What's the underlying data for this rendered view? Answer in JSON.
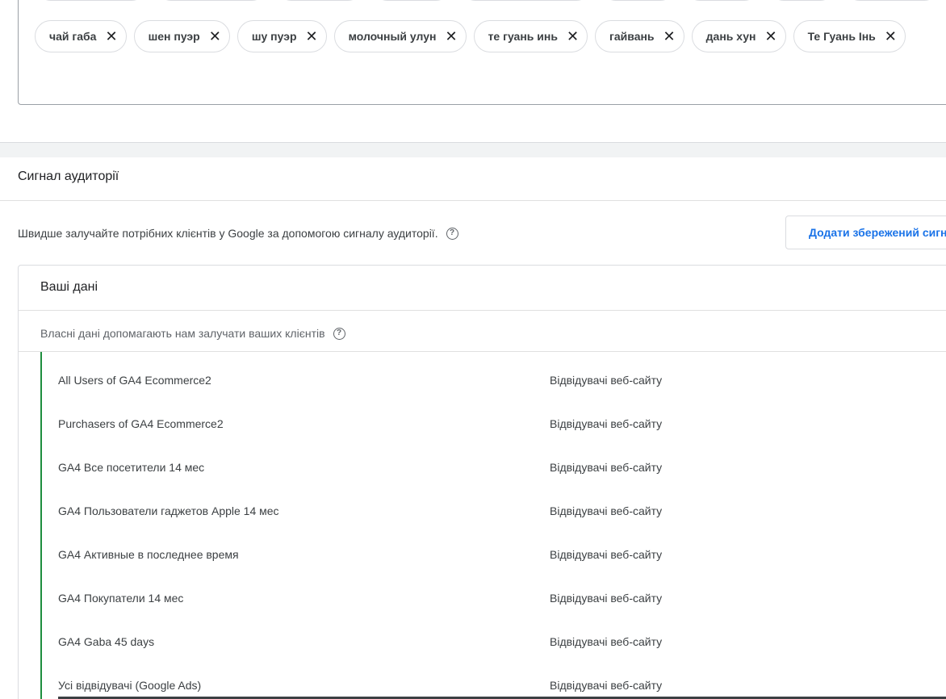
{
  "keywords": {
    "chips": [
      {
        "label": "чай габа"
      },
      {
        "label": "шен пуэр"
      },
      {
        "label": "шу пуэр"
      },
      {
        "label": "молочный улун"
      },
      {
        "label": "те гуань инь"
      },
      {
        "label": "гайвань"
      },
      {
        "label": "дань хун"
      },
      {
        "label": "Те Гуань Інь"
      }
    ],
    "remove_glyph": "✕"
  },
  "audience_signal": {
    "title": "Сигнал аудиторії",
    "description": "Швидше залучайте потрібних клієнтів у Google за допомогою сигналу аудиторії.",
    "add_saved_button": "Додати збережений сигнал",
    "help_icon": "help-circle-icon"
  },
  "your_data": {
    "title": "Ваші дані",
    "subtitle": "Власні дані допомагають нам залучати ваших клієнтів",
    "help_icon": "help-circle-icon",
    "accent_color": "#1e8e3e",
    "audiences": [
      {
        "name": "All Users of GA4 Ecommerce2",
        "type": "Відвідувачі веб-сайту"
      },
      {
        "name": "Purchasers of GA4 Ecommerce2",
        "type": "Відвідувачі веб-сайту"
      },
      {
        "name": "GA4 Все посетители 14 мес",
        "type": "Відвідувачі веб-сайту"
      },
      {
        "name": "GA4 Пользователи гаджетов Apple 14 мес",
        "type": "Відвідувачі веб-сайту"
      },
      {
        "name": "GA4 Активные в последнее время",
        "type": "Відвідувачі веб-сайту"
      },
      {
        "name": "GA4 Покупатели 14 мес",
        "type": "Відвідувачі веб-сайту"
      },
      {
        "name": "GA4 Gaba 45 days",
        "type": "Відвідувачі веб-сайту"
      },
      {
        "name": "Усі відвідувачі (Google Ads)",
        "type": "Відвідувачі веб-сайту"
      }
    ]
  }
}
